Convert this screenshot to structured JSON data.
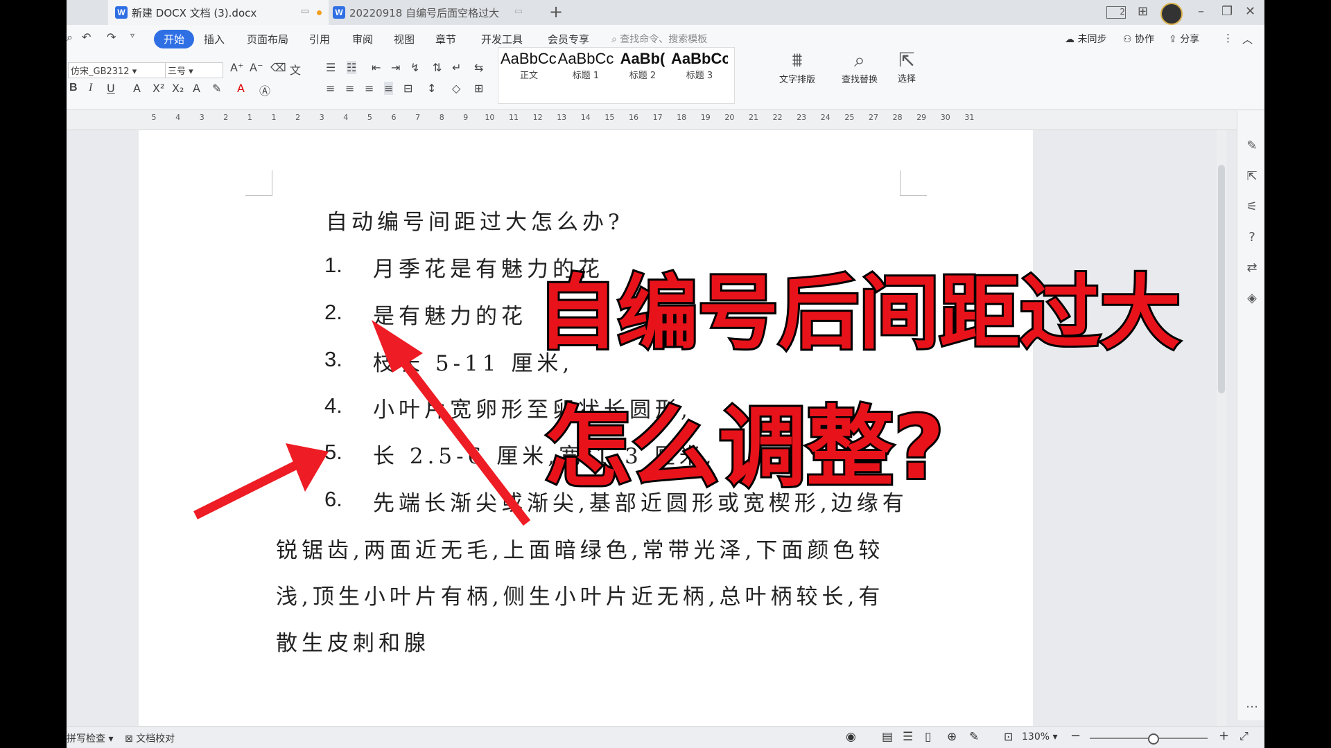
{
  "titlebar": {
    "tab1_title": "新建 DOCX 文档 (3).docx",
    "tab2_title": "20220918  自编号后面空格过大",
    "new_tab": "+",
    "page_indicator": "2"
  },
  "ribbon": {
    "menus": [
      "开始",
      "插入",
      "页面布局",
      "引用",
      "审阅",
      "视图",
      "章节",
      "开发工具",
      "会员专享"
    ],
    "search_placeholder": "查找命令、搜索模板",
    "right_actions": [
      "未同步",
      "协作",
      "分享"
    ],
    "font_name": "仿宋_GB2312",
    "font_size": "三号",
    "styles": [
      {
        "preview": "AaBbCcDd",
        "name": "正文"
      },
      {
        "preview": "AaBbCc",
        "name": "标题 1"
      },
      {
        "preview": "AaBb(",
        "name": "标题 2"
      },
      {
        "preview": "AaBbCc",
        "name": "标题 3"
      }
    ],
    "big_tools": [
      "文字排版",
      "查找替换",
      "选择"
    ]
  },
  "ruler": {
    "ticks": [
      "5",
      "4",
      "3",
      "2",
      "1",
      "1",
      "2",
      "3",
      "4",
      "5",
      "6",
      "7",
      "8",
      "9",
      "10",
      "11",
      "12",
      "13",
      "14",
      "15",
      "16",
      "17",
      "18",
      "19",
      "20",
      "21",
      "22",
      "23",
      "24",
      "25",
      "27",
      "28",
      "29",
      "30",
      "31"
    ]
  },
  "document": {
    "heading": "自动编号间距过大怎么办?",
    "items": [
      {
        "num": "1.",
        "text": "月季花是有魅力的花"
      },
      {
        "num": "2.",
        "text": "是有魅力的花"
      },
      {
        "num": "3.",
        "text": "枝长 5-11 厘米,"
      },
      {
        "num": "4.",
        "text": "小叶片宽卵形至卵状长圆形,"
      },
      {
        "num": "5.",
        "text": "长 2.5-6 厘米,宽 1-3 厘米,"
      },
      {
        "num": "6.",
        "text": "先端长渐尖或渐尖,基部近圆形或宽楔形,边缘有"
      }
    ],
    "continuation": [
      "锐锯齿,两面近无毛,上面暗绿色,常带光泽,下面颜色较",
      "浅,顶生小叶片有柄,侧生小叶片近无柄,总叶柄较长,有",
      "散生皮刺和腺"
    ]
  },
  "overlay": {
    "line1": "自编号后间距过大",
    "line2": "怎么调整?",
    "color": "#e8131a"
  },
  "statusbar": {
    "spellcheck": "拼写检查",
    "proofread": "文档校对",
    "zoom": "130%"
  }
}
